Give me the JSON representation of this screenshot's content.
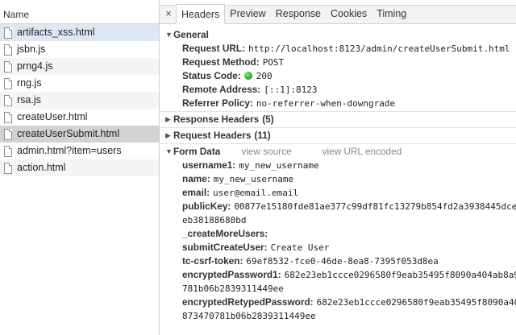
{
  "left_panel": {
    "header": "Name",
    "files": [
      "artifacts_xss.html",
      "jsbn.js",
      "prng4.js",
      "rng.js",
      "rsa.js",
      "createUser.html",
      "createUserSubmit.html",
      "admin.html?item=users",
      "action.html"
    ]
  },
  "tabs": {
    "close": "×",
    "items": [
      "Headers",
      "Preview",
      "Response",
      "Cookies",
      "Timing"
    ],
    "active": "Headers"
  },
  "general": {
    "title": "General",
    "request_url_label": "Request URL:",
    "request_url": "http://localhost:8123/admin/createUserSubmit.html",
    "request_method_label": "Request Method:",
    "request_method": "POST",
    "status_code_label": "Status Code:",
    "status_code": "200",
    "status_color": "#1aa31a",
    "remote_address_label": "Remote Address:",
    "remote_address": "[::1]:8123",
    "referrer_policy_label": "Referrer Policy:",
    "referrer_policy": "no-referrer-when-downgrade"
  },
  "response_headers": {
    "title": "Response Headers",
    "count": "(5)"
  },
  "request_headers": {
    "title": "Request Headers",
    "count": "(11)"
  },
  "form_data": {
    "title": "Form Data",
    "view_source": "view source",
    "view_url_encoded": "view URL encoded",
    "username1_label": "username1:",
    "username1": "my_new_username",
    "name_label": "name:",
    "name": "my_new_username",
    "email_label": "email:",
    "email": "user@email.email",
    "publickey_label": "publicKey:",
    "publickey": "00877e15180fde81ae377c99df81fc13279b854fd2a3938445dce",
    "publickey_cont": "eb38188680bd",
    "create_more_label": "_createMoreUsers:",
    "submit_label": "submitCreateUser:",
    "submit": "Create User",
    "csrf_label": "tc-csrf-token:",
    "csrf": "69ef8532-fce0-46de-8ea8-7395f053d8ea",
    "enc1_label": "encryptedPassword1:",
    "enc1": "682e23eb1ccce0296580f9eab35495f8090a404ab8a9",
    "enc1_cont": "781b06b2839311449ee",
    "enc2_label": "encryptedRetypedPassword:",
    "enc2": "682e23eb1ccce0296580f9eab35495f8090a40",
    "enc2_cont": "873470781b06b2839311449ee"
  }
}
